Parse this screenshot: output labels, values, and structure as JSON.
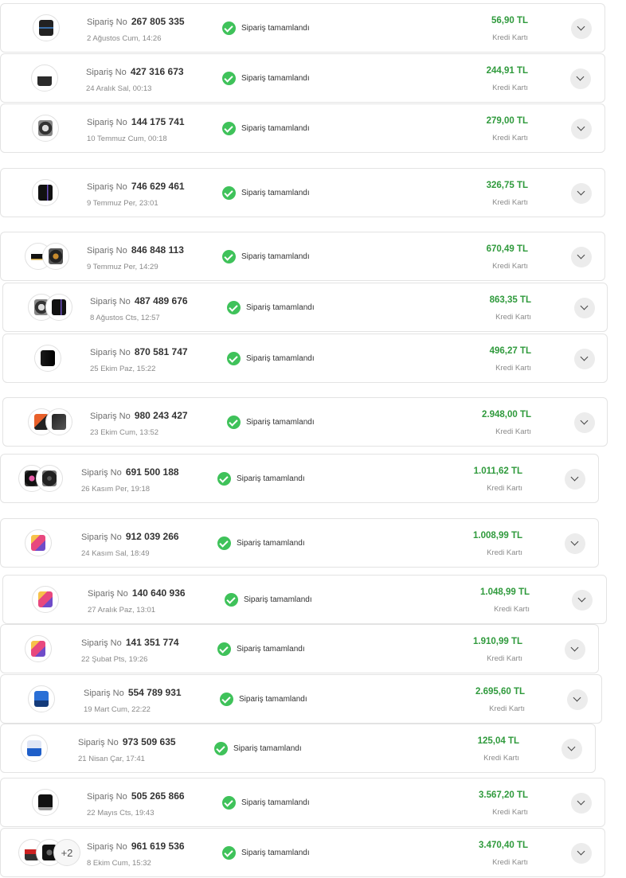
{
  "labels": {
    "order_no": "Sipariş No",
    "status": "Sipariş tamamlandı",
    "payment": "Kredi Kartı"
  },
  "colors": {
    "status_green": "#3fc25a",
    "price_green": "#2f9a3c"
  },
  "orders": [
    {
      "no": "267 805 335",
      "date": "2 Ağustos Cum, 14:26",
      "price": "56,90 TL",
      "thumbs": [
        "black-gpu"
      ]
    },
    {
      "no": "427 316 673",
      "date": "24 Aralık Sal, 00:13",
      "price": "244,91 TL",
      "thumbs": [
        "router"
      ]
    },
    {
      "no": "144 175 741",
      "date": "10 Temmuz Cum, 00:18",
      "price": "279,00 TL",
      "thumbs": [
        "hard-drive"
      ]
    },
    {
      "no": "746 629 461",
      "date": "9 Temmuz Per, 23:01",
      "price": "326,75 TL",
      "thumbs": [
        "pc-case"
      ]
    },
    {
      "no": "846 848 113",
      "date": "9 Temmuz Per, 14:29",
      "price": "670,49 TL",
      "thumbs": [
        "ram",
        "cooler"
      ]
    },
    {
      "no": "487 489 676",
      "date": "8 Ağustos Cts, 12:57",
      "price": "863,35 TL",
      "thumbs": [
        "hard-drive",
        "pc-case"
      ]
    },
    {
      "no": "870 581 747",
      "date": "25 Ekim Paz, 15:22",
      "price": "496,27 TL",
      "thumbs": [
        "pc-case-black"
      ]
    },
    {
      "no": "980 243 427",
      "date": "23 Ekim Cum, 13:52",
      "price": "2.948,00 TL",
      "thumbs": [
        "cpu",
        "motherboard"
      ]
    },
    {
      "no": "691 500 188",
      "date": "26 Kasım Per, 19:18",
      "price": "1.011,62 TL",
      "thumbs": [
        "fan-pink",
        "fan-black"
      ]
    },
    {
      "no": "912 039 266",
      "date": "24 Kasım Sal, 18:49",
      "price": "1.008,99 TL",
      "thumbs": [
        "tablet"
      ]
    },
    {
      "no": "140 640 936",
      "date": "27 Aralık Paz, 13:01",
      "price": "1.048,99 TL",
      "thumbs": [
        "tablet"
      ]
    },
    {
      "no": "141 351 774",
      "date": "22 Şubat Pts, 19:26",
      "price": "1.910,99 TL",
      "thumbs": [
        "tablet"
      ]
    },
    {
      "no": "554 789 931",
      "date": "19 Mart Cum, 22:22",
      "price": "2.695,60 TL",
      "thumbs": [
        "blue-gpu"
      ]
    },
    {
      "no": "973 509 635",
      "date": "21 Nisan Çar, 17:41",
      "price": "125,04 TL",
      "thumbs": [
        "ssd"
      ]
    },
    {
      "no": "505 265 866",
      "date": "22 Mayıs Cts, 19:43",
      "price": "3.567,20 TL",
      "thumbs": [
        "monitor"
      ]
    },
    {
      "no": "961 619 536",
      "date": "8 Ekim Cum, 15:32",
      "price": "3.470,40 TL",
      "thumbs": [
        "speaker",
        "camera"
      ],
      "more": "+2"
    }
  ]
}
